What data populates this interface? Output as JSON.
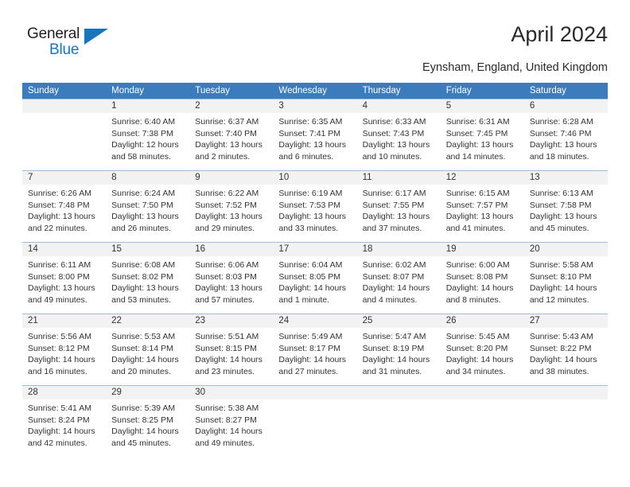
{
  "brand": {
    "name_top": "General",
    "name_bottom": "Blue",
    "accent_color": "#1b75bb"
  },
  "header": {
    "title": "April 2024",
    "location": "Eynsham, England, United Kingdom"
  },
  "theme": {
    "header_row_bg": "#3b7cbe",
    "date_band_bg": "#f2f2f2",
    "week_divider": "#9fbcd8",
    "text_color": "#333333"
  },
  "weekday_headers": [
    "Sunday",
    "Monday",
    "Tuesday",
    "Wednesday",
    "Thursday",
    "Friday",
    "Saturday"
  ],
  "labels": {
    "sunrise_prefix": "Sunrise:",
    "sunset_prefix": "Sunset:",
    "daylight_prefix": "Daylight:"
  },
  "weeks": [
    {
      "days": [
        {
          "num": "",
          "sunrise": "",
          "sunset": "",
          "daylight_line1": "",
          "daylight_line2": ""
        },
        {
          "num": "1",
          "sunrise": "Sunrise: 6:40 AM",
          "sunset": "Sunset: 7:38 PM",
          "daylight_line1": "Daylight: 12 hours",
          "daylight_line2": "and 58 minutes."
        },
        {
          "num": "2",
          "sunrise": "Sunrise: 6:37 AM",
          "sunset": "Sunset: 7:40 PM",
          "daylight_line1": "Daylight: 13 hours",
          "daylight_line2": "and 2 minutes."
        },
        {
          "num": "3",
          "sunrise": "Sunrise: 6:35 AM",
          "sunset": "Sunset: 7:41 PM",
          "daylight_line1": "Daylight: 13 hours",
          "daylight_line2": "and 6 minutes."
        },
        {
          "num": "4",
          "sunrise": "Sunrise: 6:33 AM",
          "sunset": "Sunset: 7:43 PM",
          "daylight_line1": "Daylight: 13 hours",
          "daylight_line2": "and 10 minutes."
        },
        {
          "num": "5",
          "sunrise": "Sunrise: 6:31 AM",
          "sunset": "Sunset: 7:45 PM",
          "daylight_line1": "Daylight: 13 hours",
          "daylight_line2": "and 14 minutes."
        },
        {
          "num": "6",
          "sunrise": "Sunrise: 6:28 AM",
          "sunset": "Sunset: 7:46 PM",
          "daylight_line1": "Daylight: 13 hours",
          "daylight_line2": "and 18 minutes."
        }
      ]
    },
    {
      "days": [
        {
          "num": "7",
          "sunrise": "Sunrise: 6:26 AM",
          "sunset": "Sunset: 7:48 PM",
          "daylight_line1": "Daylight: 13 hours",
          "daylight_line2": "and 22 minutes."
        },
        {
          "num": "8",
          "sunrise": "Sunrise: 6:24 AM",
          "sunset": "Sunset: 7:50 PM",
          "daylight_line1": "Daylight: 13 hours",
          "daylight_line2": "and 26 minutes."
        },
        {
          "num": "9",
          "sunrise": "Sunrise: 6:22 AM",
          "sunset": "Sunset: 7:52 PM",
          "daylight_line1": "Daylight: 13 hours",
          "daylight_line2": "and 29 minutes."
        },
        {
          "num": "10",
          "sunrise": "Sunrise: 6:19 AM",
          "sunset": "Sunset: 7:53 PM",
          "daylight_line1": "Daylight: 13 hours",
          "daylight_line2": "and 33 minutes."
        },
        {
          "num": "11",
          "sunrise": "Sunrise: 6:17 AM",
          "sunset": "Sunset: 7:55 PM",
          "daylight_line1": "Daylight: 13 hours",
          "daylight_line2": "and 37 minutes."
        },
        {
          "num": "12",
          "sunrise": "Sunrise: 6:15 AM",
          "sunset": "Sunset: 7:57 PM",
          "daylight_line1": "Daylight: 13 hours",
          "daylight_line2": "and 41 minutes."
        },
        {
          "num": "13",
          "sunrise": "Sunrise: 6:13 AM",
          "sunset": "Sunset: 7:58 PM",
          "daylight_line1": "Daylight: 13 hours",
          "daylight_line2": "and 45 minutes."
        }
      ]
    },
    {
      "days": [
        {
          "num": "14",
          "sunrise": "Sunrise: 6:11 AM",
          "sunset": "Sunset: 8:00 PM",
          "daylight_line1": "Daylight: 13 hours",
          "daylight_line2": "and 49 minutes."
        },
        {
          "num": "15",
          "sunrise": "Sunrise: 6:08 AM",
          "sunset": "Sunset: 8:02 PM",
          "daylight_line1": "Daylight: 13 hours",
          "daylight_line2": "and 53 minutes."
        },
        {
          "num": "16",
          "sunrise": "Sunrise: 6:06 AM",
          "sunset": "Sunset: 8:03 PM",
          "daylight_line1": "Daylight: 13 hours",
          "daylight_line2": "and 57 minutes."
        },
        {
          "num": "17",
          "sunrise": "Sunrise: 6:04 AM",
          "sunset": "Sunset: 8:05 PM",
          "daylight_line1": "Daylight: 14 hours",
          "daylight_line2": "and 1 minute."
        },
        {
          "num": "18",
          "sunrise": "Sunrise: 6:02 AM",
          "sunset": "Sunset: 8:07 PM",
          "daylight_line1": "Daylight: 14 hours",
          "daylight_line2": "and 4 minutes."
        },
        {
          "num": "19",
          "sunrise": "Sunrise: 6:00 AM",
          "sunset": "Sunset: 8:08 PM",
          "daylight_line1": "Daylight: 14 hours",
          "daylight_line2": "and 8 minutes."
        },
        {
          "num": "20",
          "sunrise": "Sunrise: 5:58 AM",
          "sunset": "Sunset: 8:10 PM",
          "daylight_line1": "Daylight: 14 hours",
          "daylight_line2": "and 12 minutes."
        }
      ]
    },
    {
      "days": [
        {
          "num": "21",
          "sunrise": "Sunrise: 5:56 AM",
          "sunset": "Sunset: 8:12 PM",
          "daylight_line1": "Daylight: 14 hours",
          "daylight_line2": "and 16 minutes."
        },
        {
          "num": "22",
          "sunrise": "Sunrise: 5:53 AM",
          "sunset": "Sunset: 8:14 PM",
          "daylight_line1": "Daylight: 14 hours",
          "daylight_line2": "and 20 minutes."
        },
        {
          "num": "23",
          "sunrise": "Sunrise: 5:51 AM",
          "sunset": "Sunset: 8:15 PM",
          "daylight_line1": "Daylight: 14 hours",
          "daylight_line2": "and 23 minutes."
        },
        {
          "num": "24",
          "sunrise": "Sunrise: 5:49 AM",
          "sunset": "Sunset: 8:17 PM",
          "daylight_line1": "Daylight: 14 hours",
          "daylight_line2": "and 27 minutes."
        },
        {
          "num": "25",
          "sunrise": "Sunrise: 5:47 AM",
          "sunset": "Sunset: 8:19 PM",
          "daylight_line1": "Daylight: 14 hours",
          "daylight_line2": "and 31 minutes."
        },
        {
          "num": "26",
          "sunrise": "Sunrise: 5:45 AM",
          "sunset": "Sunset: 8:20 PM",
          "daylight_line1": "Daylight: 14 hours",
          "daylight_line2": "and 34 minutes."
        },
        {
          "num": "27",
          "sunrise": "Sunrise: 5:43 AM",
          "sunset": "Sunset: 8:22 PM",
          "daylight_line1": "Daylight: 14 hours",
          "daylight_line2": "and 38 minutes."
        }
      ]
    },
    {
      "days": [
        {
          "num": "28",
          "sunrise": "Sunrise: 5:41 AM",
          "sunset": "Sunset: 8:24 PM",
          "daylight_line1": "Daylight: 14 hours",
          "daylight_line2": "and 42 minutes."
        },
        {
          "num": "29",
          "sunrise": "Sunrise: 5:39 AM",
          "sunset": "Sunset: 8:25 PM",
          "daylight_line1": "Daylight: 14 hours",
          "daylight_line2": "and 45 minutes."
        },
        {
          "num": "30",
          "sunrise": "Sunrise: 5:38 AM",
          "sunset": "Sunset: 8:27 PM",
          "daylight_line1": "Daylight: 14 hours",
          "daylight_line2": "and 49 minutes."
        },
        {
          "num": "",
          "sunrise": "",
          "sunset": "",
          "daylight_line1": "",
          "daylight_line2": ""
        },
        {
          "num": "",
          "sunrise": "",
          "sunset": "",
          "daylight_line1": "",
          "daylight_line2": ""
        },
        {
          "num": "",
          "sunrise": "",
          "sunset": "",
          "daylight_line1": "",
          "daylight_line2": ""
        },
        {
          "num": "",
          "sunrise": "",
          "sunset": "",
          "daylight_line1": "",
          "daylight_line2": ""
        }
      ]
    }
  ]
}
